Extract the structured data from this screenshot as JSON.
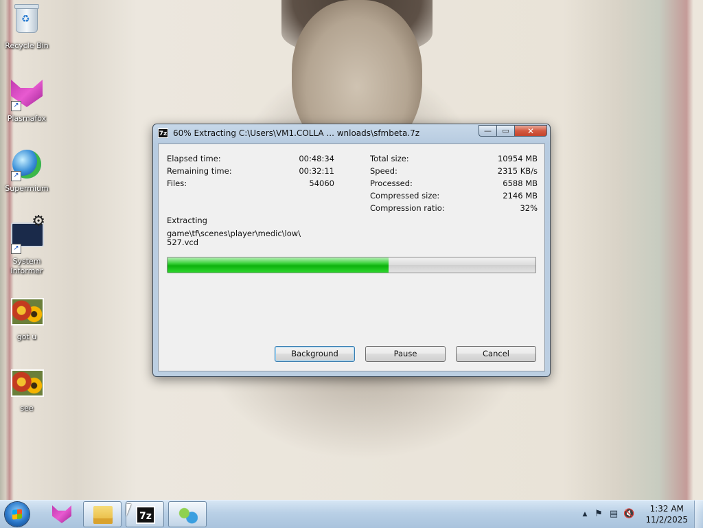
{
  "desktop": {
    "icons": [
      {
        "label": "Recycle Bin",
        "icon": "recycle-bin-icon"
      },
      {
        "label": "Plasmafox",
        "icon": "plasmafox-icon"
      },
      {
        "label": "Supermium",
        "icon": "supermium-icon"
      },
      {
        "label": "System Informer",
        "icon": "system-informer-icon"
      },
      {
        "label": "got u",
        "icon": "image-file-icon"
      },
      {
        "label": "see",
        "icon": "image-file-icon"
      }
    ]
  },
  "dialog": {
    "title": "60% Extracting C:\\Users\\VM1.COLLA ... wnloads\\sfmbeta.7z",
    "app_icon_text": "7z",
    "caption": {
      "minimize": "—",
      "maximize": "▭",
      "close": "✕"
    },
    "stats_left": [
      {
        "label": "Elapsed time:",
        "value": "00:48:34"
      },
      {
        "label": "Remaining time:",
        "value": "00:32:11"
      },
      {
        "label": "Files:",
        "value": "54060"
      }
    ],
    "stats_right": [
      {
        "label": "Total size:",
        "value": "10954 MB"
      },
      {
        "label": "Speed:",
        "value": "2315 KB/s"
      },
      {
        "label": "Processed:",
        "value": "6588 MB"
      },
      {
        "label": "Compressed size:",
        "value": "2146 MB"
      },
      {
        "label": "Compression ratio:",
        "value": "32%"
      }
    ],
    "status_label": "Extracting",
    "current_path_line1": "game\\tf\\scenes\\player\\medic\\low\\",
    "current_path_line2": "527.vcd",
    "progress_fraction": 0.6,
    "buttons": {
      "background": "Background",
      "pause": "Pause",
      "cancel": "Cancel"
    }
  },
  "taskbar": {
    "items": [
      {
        "icon": "plasmafox-icon"
      },
      {
        "icon": "file-explorer-icon"
      },
      {
        "icon": "7zip-icon",
        "text": "7z"
      },
      {
        "icon": "network-users-icon"
      }
    ],
    "tray": {
      "chevron": "▲",
      "flag": "⚑",
      "network": "▤",
      "volume": "🔇"
    },
    "clock": {
      "time": "1:32 AM",
      "date": "11/2/2025"
    }
  },
  "colors": {
    "progress_fill": "#0db20d",
    "titlebar": "#b7cbe0",
    "close_button": "#c4432b",
    "taskbar": "#b9d0e6"
  }
}
